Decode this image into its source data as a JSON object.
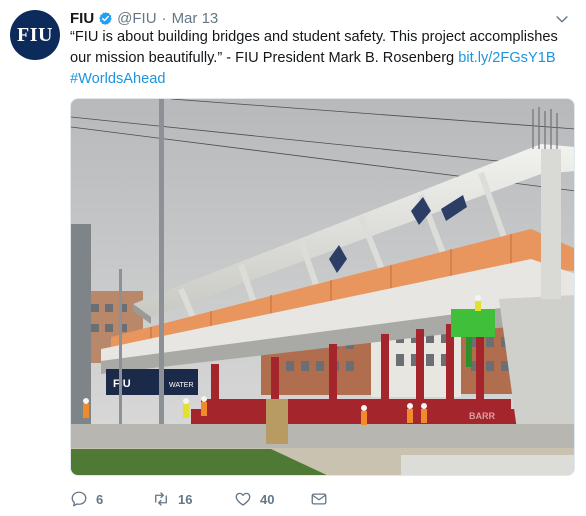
{
  "account": {
    "avatar_text": "FIU",
    "name": "FIU",
    "handle": "@FIU",
    "separator": "·",
    "date": "Mar 13"
  },
  "tweet": {
    "text": "“FIU is about building bridges and student safety. This project accomplishes our mission beautifully.” - FIU President Mark B. Rosenberg ",
    "link_text": "bit.ly/2FGsY1B",
    "hashtag": "#WorldsAhead"
  },
  "photo": {
    "sign_text": "FIU",
    "sign_text_2": "WATER",
    "truck_text": "BARR"
  },
  "actions": {
    "replies": "6",
    "retweets": "16",
    "likes": "40"
  },
  "colors": {
    "link": "#1b95e0",
    "verified": "#1da1f2",
    "muted": "#657786",
    "avatar_bg": "#0c2a5a"
  }
}
